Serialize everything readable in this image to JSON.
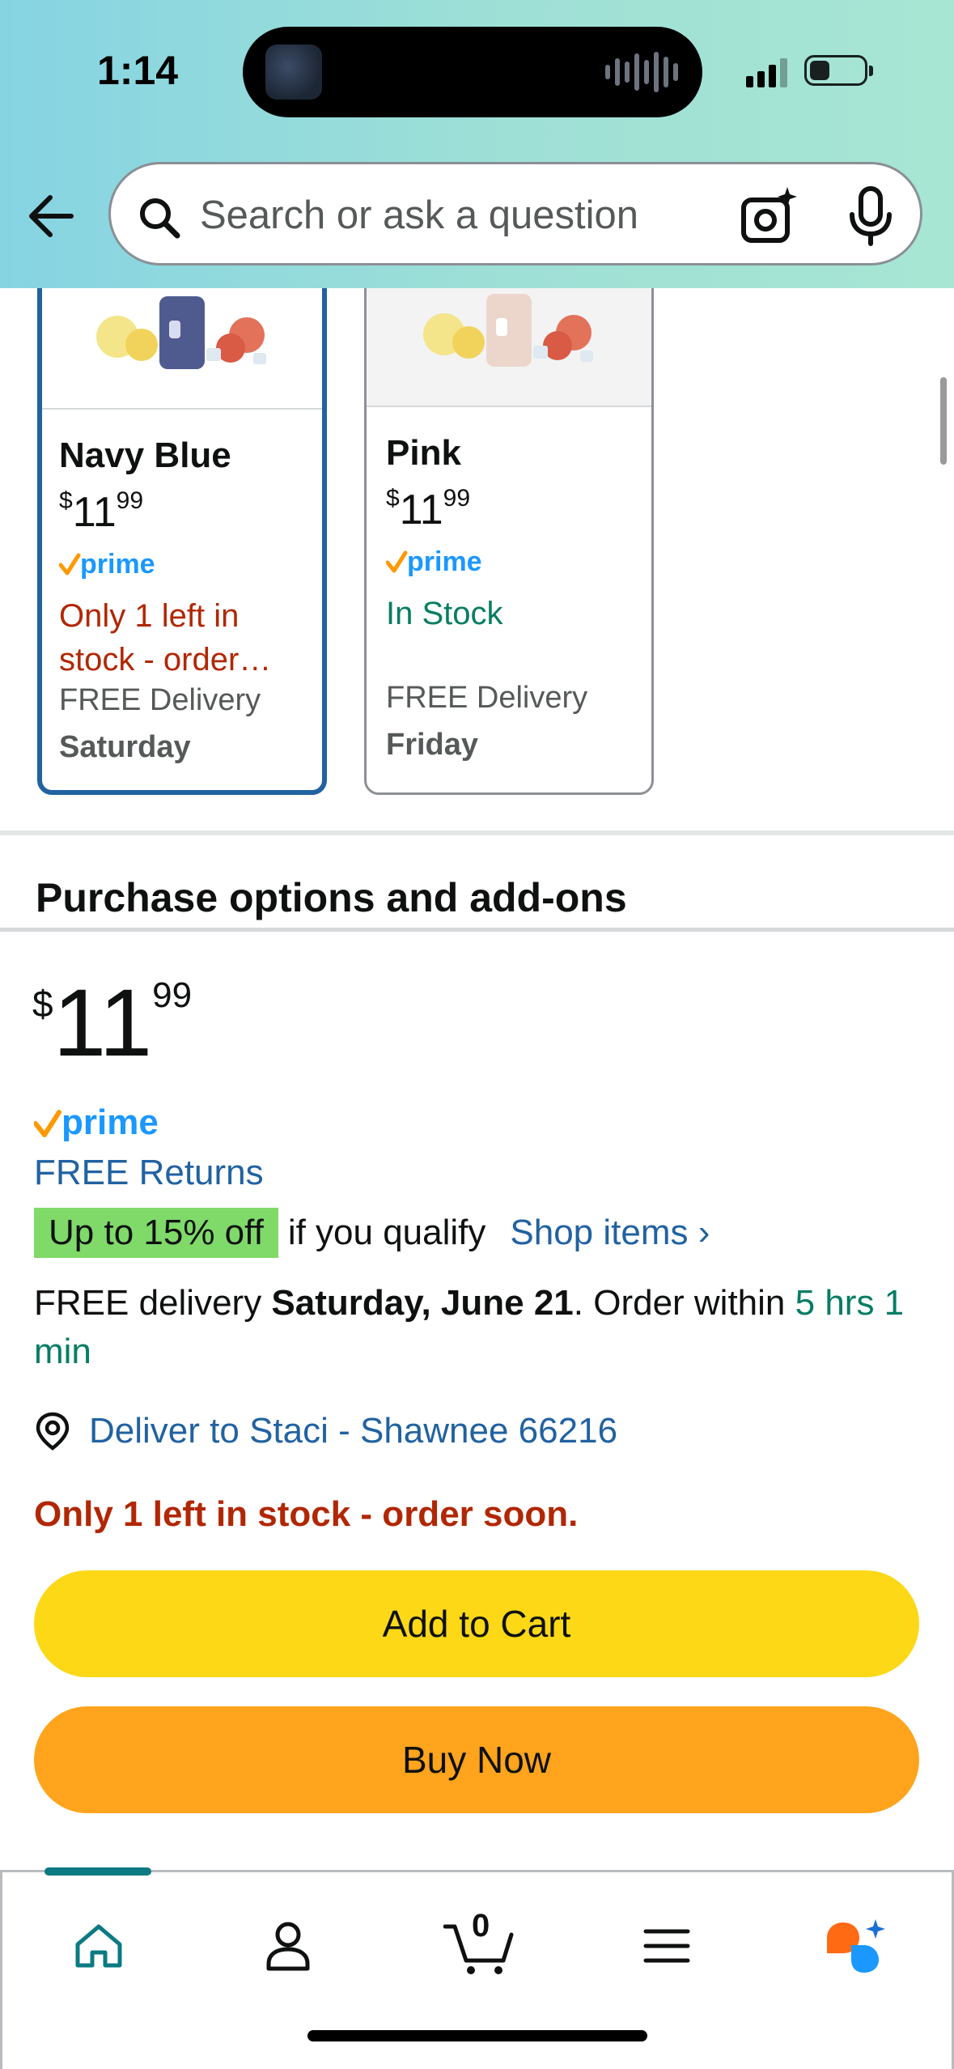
{
  "status_bar": {
    "time": "1:14"
  },
  "search": {
    "placeholder": "Search or ask a question"
  },
  "variants": [
    {
      "name": "Navy Blue",
      "price_symbol": "$",
      "price_whole": "11",
      "price_fraction": "99",
      "prime": "prime",
      "availability": "Only 1 left in stock - order…",
      "delivery_label": "FREE Delivery",
      "delivery_day": "Saturday",
      "selected": true
    },
    {
      "name": "Pink",
      "price_symbol": "$",
      "price_whole": "11",
      "price_fraction": "99",
      "prime": "prime",
      "availability": "In Stock",
      "delivery_label": "FREE Delivery",
      "delivery_day": "Friday",
      "selected": false
    }
  ],
  "purchase": {
    "section_title": "Purchase options and add-ons",
    "price_symbol": "$",
    "price_whole": "11",
    "price_fraction": "99",
    "prime": "prime",
    "free_returns": "FREE Returns",
    "promo_badge": "Up to 15% off",
    "promo_text": "if you qualify",
    "promo_link": "Shop items ›",
    "delivery_prefix": "FREE delivery ",
    "delivery_date": "Saturday, June 21",
    "delivery_middle": ". Order within ",
    "delivery_countdown": "5 hrs 1 min",
    "deliver_to": "Deliver to Staci - Shawnee 66216",
    "stock_warning": "Only 1 left in stock - order soon.",
    "add_to_cart": "Add to Cart",
    "buy_now": "Buy Now"
  },
  "bottom_nav": {
    "cart_count": "0",
    "items": [
      "home-icon",
      "account-icon",
      "cart-icon",
      "menu-icon",
      "rufus-ai-icon"
    ]
  },
  "colors": {
    "link_blue": "#2162a1",
    "alert_red": "#b12704",
    "stock_green": "#067d62",
    "cart_yellow": "#fcd817",
    "buy_orange": "#ffa41c",
    "promo_green": "#7fda69",
    "prime_blue": "#1a98ff",
    "prime_check": "#ff9900"
  }
}
